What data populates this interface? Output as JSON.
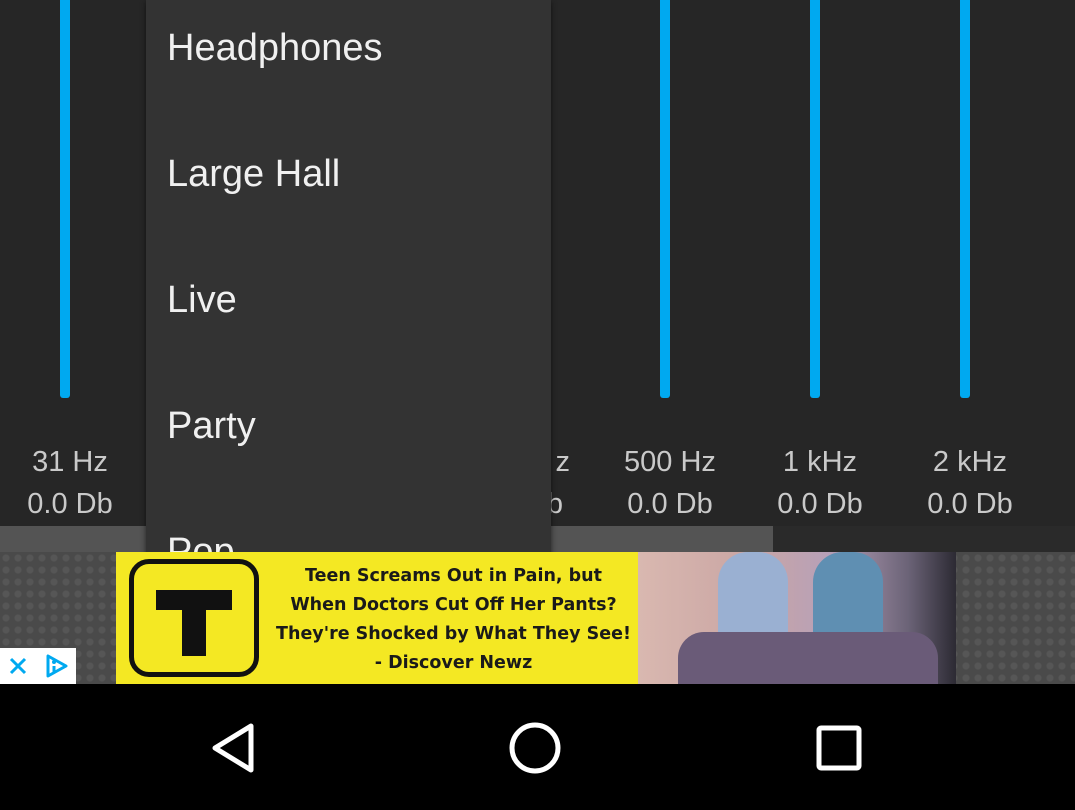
{
  "colors": {
    "eq_panel_bg": "#262626",
    "eq_bar": "#00a9f0",
    "dropdown_bg": "#333333",
    "dropdown_text": "#f0f0f0",
    "ad_yellow": "#f4e823",
    "navbar_bg": "#000000"
  },
  "equalizer": {
    "bands": [
      {
        "freq": "31 Hz",
        "gain": "0.0 Db"
      },
      {
        "freq": "",
        "gain": ""
      },
      {
        "freq": "",
        "gain": ""
      },
      {
        "freq": "z",
        "gain": "b"
      },
      {
        "freq": "500 Hz",
        "gain": "0.0 Db"
      },
      {
        "freq": "1 kHz",
        "gain": "0.0 Db"
      },
      {
        "freq": "2 kHz",
        "gain": "0.0 Db"
      }
    ]
  },
  "preset_dropdown": {
    "items": [
      "Headphones",
      "Large Hall",
      "Live",
      "Party",
      "Pop"
    ]
  },
  "ad": {
    "text_lines": [
      "Teen Screams Out in Pain, but",
      "When Doctors Cut Off Her Pants?",
      "They're Shocked by What They See!",
      "- Discover Newz"
    ],
    "logo_icon": "t-logo-icon",
    "close_icon": "close-icon",
    "adchoices_icon": "adchoices-icon"
  },
  "navbar": {
    "back_icon": "back-triangle-icon",
    "home_icon": "home-circle-icon",
    "recents_icon": "recents-square-icon"
  }
}
